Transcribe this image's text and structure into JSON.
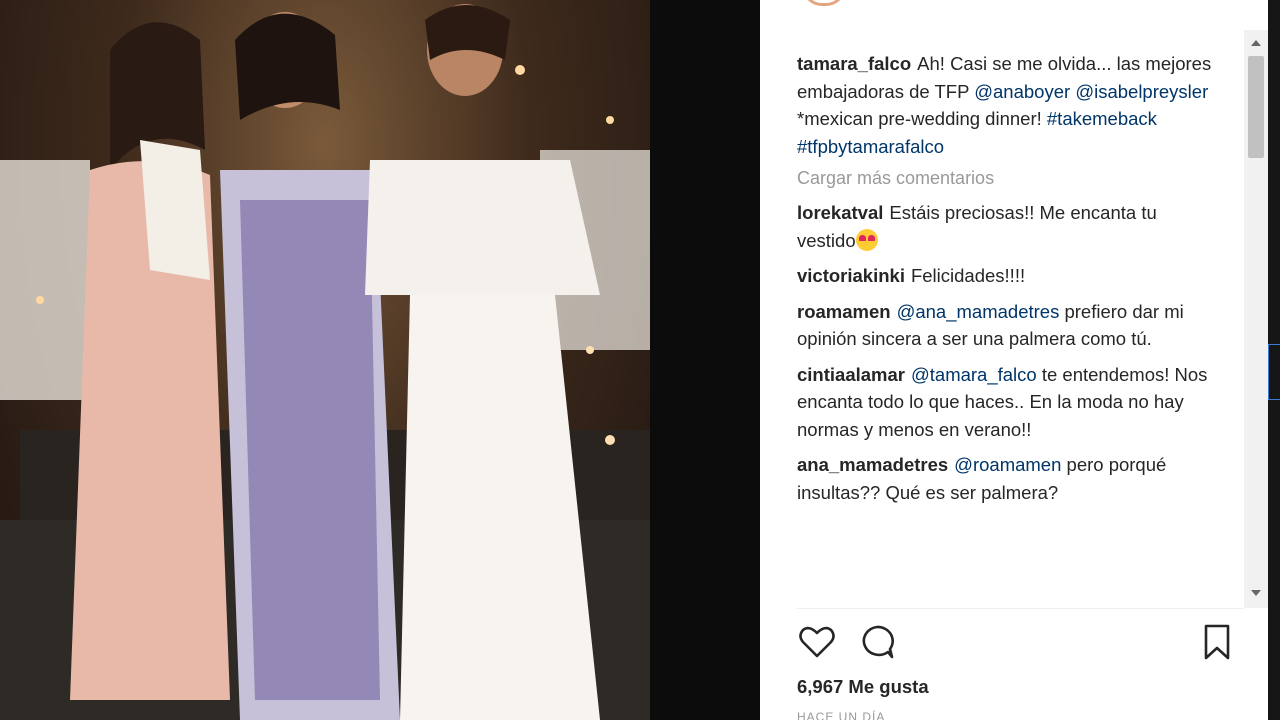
{
  "post": {
    "caption": {
      "user": "tamara_falco",
      "text_1": "Ah! Casi se me olvida... las mejores embajadoras de TFP",
      "mention_1": "@anaboyer",
      "mention_2": "@isabelpreysler",
      "text_2": "*mexican pre-wedding dinner!",
      "hashtag_1": "#takemeback",
      "hashtag_2": "#tfpbytamarafalco"
    },
    "load_more_label": "Cargar más comentarios",
    "comments": [
      {
        "user": "lorekatval",
        "text": "Estáis preciosas!! Me encanta tu vestido",
        "emoji": "heart-eyes-emoji"
      },
      {
        "user": "victoriakinki",
        "text": "Felicidades!!!!"
      },
      {
        "user": "roamamen",
        "mention": "@ana_mamadetres",
        "text": "prefiero dar mi opinión sincera a ser una palmera como tú."
      },
      {
        "user": "cintiaalamar",
        "mention": "@tamara_falco",
        "text": "te entendemos! Nos encanta todo lo que haces.. En la moda no hay normas y menos en verano!!"
      },
      {
        "user": "ana_mamadetres",
        "mention": "@roamamen",
        "text": "pero porqué insultas?? Qué es ser palmera?"
      }
    ],
    "likes_label": "6,967 Me gusta",
    "time_label": "HACE UN DÍA"
  },
  "icons": {
    "like": "heart-icon",
    "comment": "comment-bubble-icon",
    "save": "bookmark-icon",
    "scroll_up": "scroll-up-arrow-icon",
    "scroll_down": "scroll-down-arrow-icon"
  },
  "colors": {
    "link": "#003569",
    "username": "#262626",
    "muted": "#999999"
  }
}
